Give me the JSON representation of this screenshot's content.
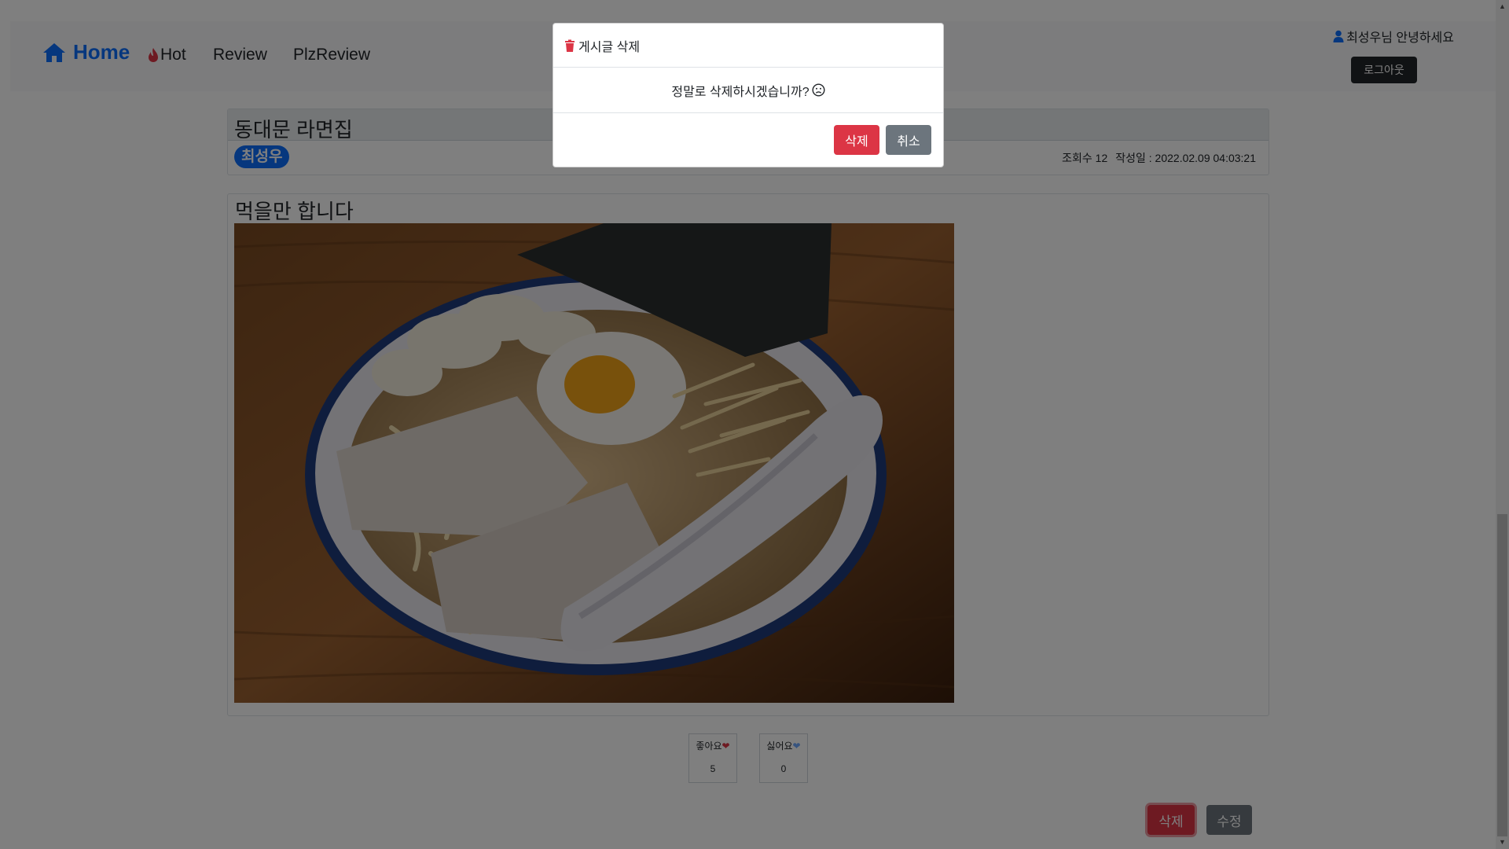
{
  "colors": {
    "primary": "#0d6efd",
    "danger": "#dc3545",
    "secondary": "#6c757d",
    "dark": "#212529",
    "hot_flame": "#dc3545",
    "like_heart": "#dc3545",
    "dislike_heart": "#6ea8fe",
    "trash": "#dc3545"
  },
  "navbar": {
    "brand_icon": "home-icon",
    "brand_label": "Home",
    "hot_icon": "fire-icon",
    "hot_label": "Hot",
    "review_label": "Review",
    "plzreview_label": "PlzReview",
    "user_icon": "person-icon",
    "greeting": "최성우님 안녕하세요",
    "logout_label": "로그아웃"
  },
  "post": {
    "title": "동대문 라면집",
    "author": "최성우",
    "views_text": "조회수 12",
    "date_text": "작성일 : 2022.02.09 04:03:21",
    "content_title": "먹을만 합니다",
    "image_icon": "ramen-photo"
  },
  "reactions": {
    "like_label": "좋아요",
    "like_count": "5",
    "dislike_label": "싫어요",
    "dislike_count": "0"
  },
  "actions": {
    "delete_label": "삭제",
    "edit_label": "수정"
  },
  "modal": {
    "title_icon": "trash-icon",
    "title": "게시글 삭제",
    "message": "정말로 삭제하시겠습니까?",
    "message_icon": "frown-face-icon",
    "confirm_label": "삭제",
    "cancel_label": "취소"
  }
}
